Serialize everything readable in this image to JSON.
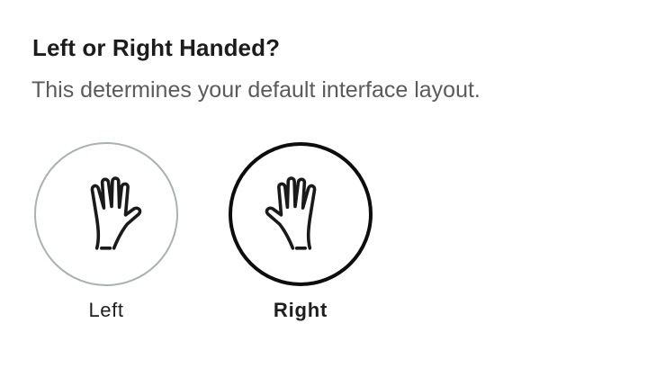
{
  "prompt": {
    "title": "Left or Right Handed?",
    "subtitle": "This determines your default interface layout."
  },
  "options": [
    {
      "label": "Left",
      "selected": false,
      "icon": "left-hand-icon"
    },
    {
      "label": "Right",
      "selected": true,
      "icon": "right-hand-icon"
    }
  ],
  "colors": {
    "selected_border": "#0d0d0d",
    "unselected_border": "#a9b2b0",
    "subtitle_text": "#5b5b5b"
  }
}
